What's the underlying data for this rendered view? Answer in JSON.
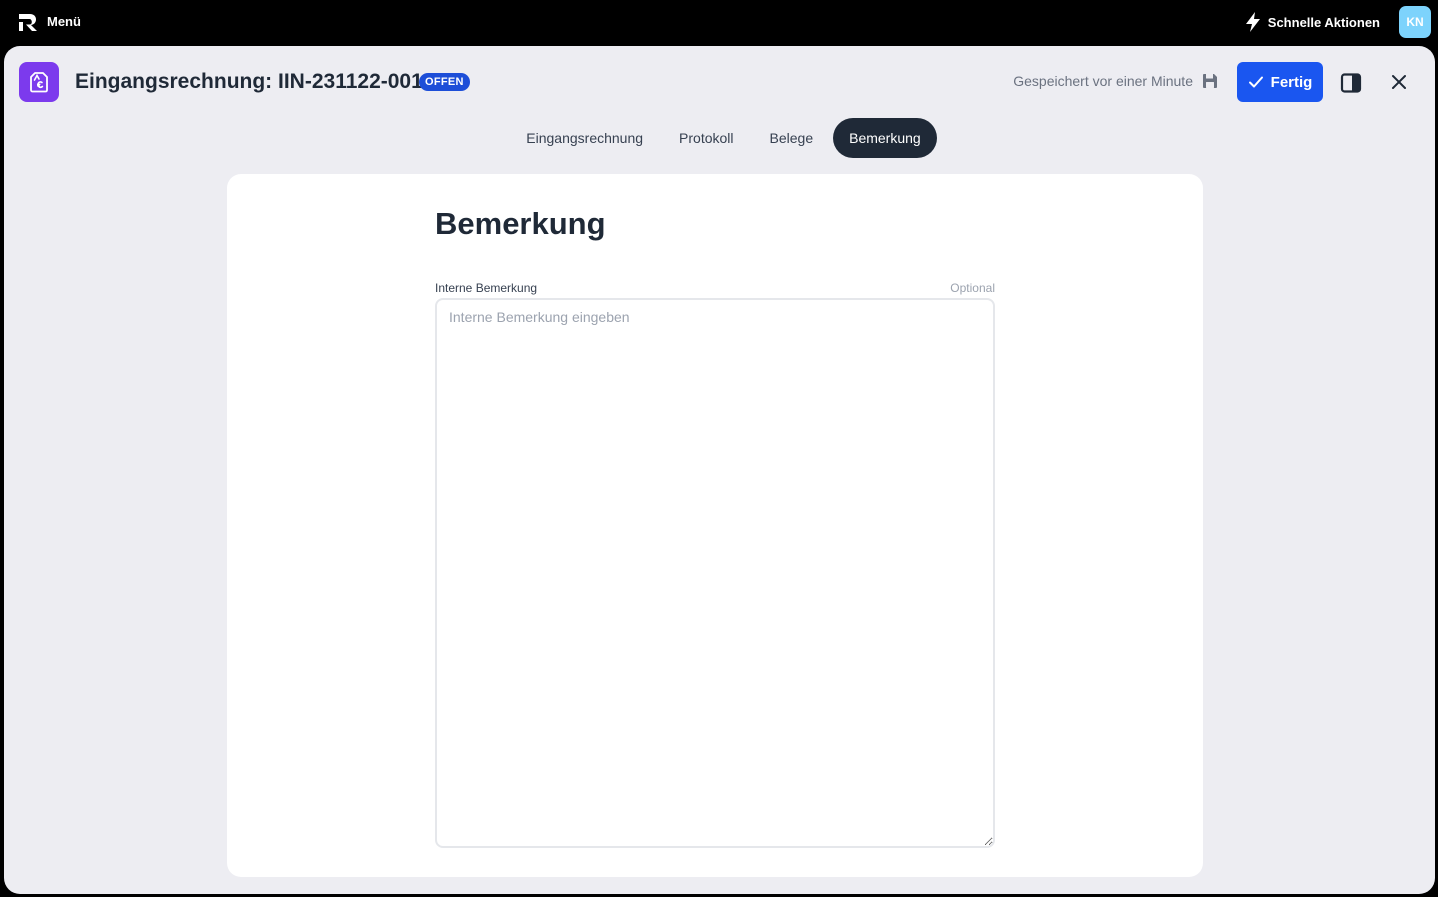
{
  "topbar": {
    "menu_label": "Menü",
    "quick_actions_label": "Schnelle Aktionen",
    "avatar_initials": "KN"
  },
  "header": {
    "title": "Eingangsrechnung: IIN-231122-001",
    "status_badge": "OFFEN",
    "saved_text": "Gespeichert vor einer Minute",
    "done_label": "Fertig"
  },
  "tabs": [
    {
      "label": "Eingangsrechnung",
      "active": false
    },
    {
      "label": "Protokoll",
      "active": false
    },
    {
      "label": "Belege",
      "active": false
    },
    {
      "label": "Bemerkung",
      "active": true
    }
  ],
  "content": {
    "heading": "Bemerkung",
    "field_label": "Interne Bemerkung",
    "optional_label": "Optional",
    "placeholder": "Interne Bemerkung eingeben",
    "value": ""
  },
  "colors": {
    "accent": "#1a56f0",
    "brand_purple": "#7c3aed",
    "active_tab": "#1f2937",
    "avatar": "#7dd3fc"
  },
  "icons": [
    "logo-icon",
    "bolt-icon",
    "invoice-icon",
    "save-icon",
    "check-icon",
    "sidebar-toggle-icon",
    "close-icon"
  ]
}
